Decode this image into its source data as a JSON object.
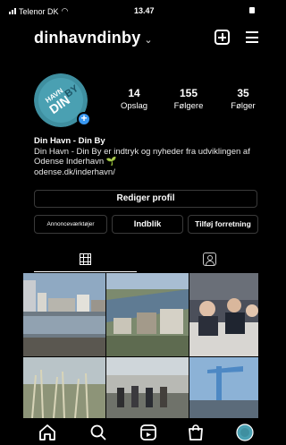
{
  "status_bar": {
    "carrier": "Telenor DK",
    "time": "13.47"
  },
  "profile": {
    "username": "dinhavndinby",
    "avatar_text_1": "HAVN",
    "avatar_text_2": "DIN",
    "avatar_text_3": "BY",
    "stats": {
      "posts_count": "14",
      "posts_label": "Opslag",
      "followers_count": "155",
      "followers_label": "Følgere",
      "following_count": "35",
      "following_label": "Følger"
    },
    "name": "Din Havn - Din By",
    "bio_line": "Din Havn - Din By er indtryk og nyheder fra udviklingen af Odense Inderhavn 🌱",
    "link": "odense.dk/inderhavn/"
  },
  "actions": {
    "edit_profile": "Rediger profil",
    "ad_tools": "Annonceværktøjer",
    "insights": "Indblik",
    "add_shop": "Tilføj forretning"
  },
  "tabs": [
    {
      "name": "grid",
      "icon": "grid-icon",
      "active": true
    },
    {
      "name": "tagged",
      "icon": "tagged-icon",
      "active": false
    }
  ],
  "bottom_nav": [
    {
      "name": "home",
      "icon": "home-icon"
    },
    {
      "name": "search",
      "icon": "search-icon"
    },
    {
      "name": "reels",
      "icon": "reels-icon"
    },
    {
      "name": "shop",
      "icon": "shop-icon"
    },
    {
      "name": "profile",
      "icon": "profile-avatar-icon"
    }
  ],
  "colors": {
    "background": "#000000",
    "accent_blue": "#3897f0",
    "avatar_teal": "#3f8fa0"
  }
}
